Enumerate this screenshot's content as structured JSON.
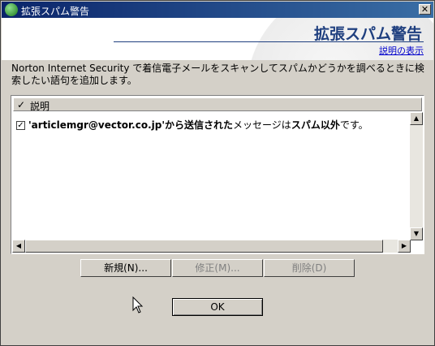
{
  "window": {
    "title": "拡張スパム警告",
    "close_glyph": "✕"
  },
  "header": {
    "title": "拡張スパム警告",
    "help_link": "説明の表示"
  },
  "description": "Norton Internet Security で着信電子メールをスキャンしてスパムかどうかを調べるときに検索したい語句を追加します。",
  "list": {
    "header_check": "✓",
    "column_label": "説明",
    "rows": [
      {
        "checked": "✓",
        "text_prefix": "'articlemgr@vector.co.jp'",
        "text_bold1": "から送信された",
        "text_mid": "メッセージは",
        "text_bold2": "スパム以外",
        "text_suffix": "です。"
      }
    ]
  },
  "buttons": {
    "new": "新規(N)...",
    "edit": "修正(M)...",
    "delete": "削除(D)",
    "ok": "OK"
  },
  "scroll": {
    "up": "▲",
    "down": "▼",
    "left": "◀",
    "right": "▶"
  }
}
